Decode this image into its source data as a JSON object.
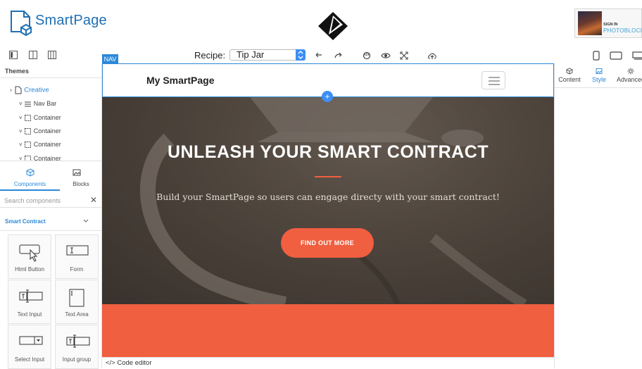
{
  "app": {
    "logo_text": "SmartPage"
  },
  "signin": {
    "small": "SIGN IN",
    "brand": "PHOTOBLOCK"
  },
  "toolbar": {
    "nav_tag": "NAV",
    "recipe_label": "Recipe:",
    "recipe_value": "Tip Jar"
  },
  "layers": {
    "heading": "Themes",
    "items": [
      "Creative",
      "Nav Bar",
      "Container",
      "Container",
      "Container",
      "Container"
    ]
  },
  "left_tabs": {
    "components": "Components",
    "blocks": "Blocks"
  },
  "search": {
    "placeholder": "Search components",
    "clear": "✕"
  },
  "category": {
    "name": "Smart Contract"
  },
  "components": [
    "Html Button",
    "Form",
    "Text Input",
    "Text Area",
    "Select Input",
    "Input group"
  ],
  "page": {
    "brand": "My SmartPage",
    "hero_title": "UNLEASH YOUR SMART CONTRACT",
    "hero_subtitle": "Build your SmartPage so users can engage directy with your smart contract!",
    "cta": "FIND OUT MORE",
    "add_symbol": "+"
  },
  "code_editor": {
    "label": "</> Code editor"
  },
  "right_tabs": {
    "content": "Content",
    "style": "Style",
    "advanced": "Advanced"
  },
  "colors": {
    "accent": "#2b88d8",
    "cta": "#f05f40",
    "brand_blue": "#1f6fb3"
  }
}
